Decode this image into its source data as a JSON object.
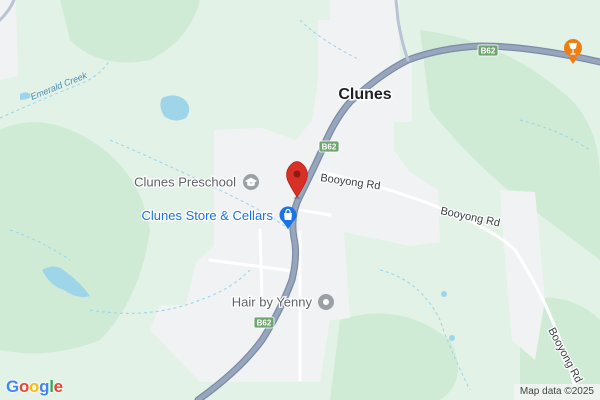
{
  "map": {
    "town": "Clunes",
    "creek": "Emerald Creek",
    "road_badges": [
      "B62",
      "B62",
      "B62"
    ],
    "roads": [
      "Booyong Rd",
      "Booyong Rd",
      "Booyong Rd"
    ],
    "pois": [
      {
        "name": "Clunes Preschool",
        "icon": "school-icon"
      },
      {
        "name": "Clunes Store & Cellars",
        "icon": "shopping-bag-icon"
      },
      {
        "name": "Hair by Yenny",
        "icon": "place-icon"
      },
      {
        "name": "",
        "icon": "bar-icon"
      }
    ],
    "marker": {
      "icon": "location-pin-icon"
    }
  },
  "footer": {
    "logo_letters": [
      "G",
      "o",
      "o",
      "g",
      "l",
      "e"
    ],
    "attribution": "Map data ©2025"
  },
  "colors": {
    "land": "#e3f2e7",
    "urban": "#f1f2f4",
    "highway": "#8e9db5",
    "water": "#9fd5e9",
    "poi_gray": "#9aa0a6",
    "poi_blue": "#1a73e8",
    "poi_orange": "#f07d10",
    "marker": "#d93025"
  }
}
